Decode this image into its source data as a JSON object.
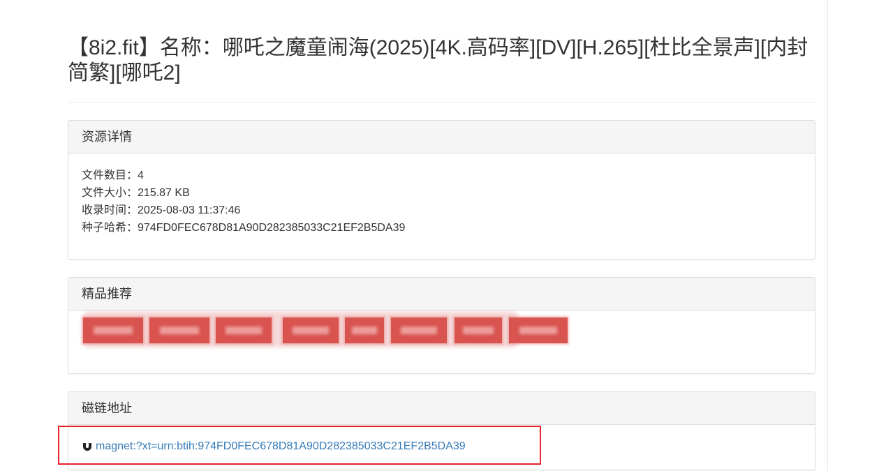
{
  "title": "【8i2.fit】名称：哪吒之魔童闹海(2025)[4K.高码率][DV][H.265][杜比全景声][内封简繁][哪吒2]",
  "details": {
    "heading": "资源详情",
    "rows": [
      {
        "label": "文件数目：",
        "value": "4"
      },
      {
        "label": "文件大小：",
        "value": "215.87 KB"
      },
      {
        "label": "收录时间：",
        "value": "2025-08-03 11:37:46"
      },
      {
        "label": "种子哈希：",
        "value": "974FD0FEC678D81A90D282385033C21EF2B5DA39"
      }
    ]
  },
  "recommend": {
    "heading": "精品推荐",
    "redacted_count": 8,
    "redaction_color": "#d9534f"
  },
  "magnet": {
    "heading": "磁链地址",
    "icon": "magnet-icon",
    "link_text": "magnet:?xt=urn:btih:974FD0FEC678D81A90D282385033C21EF2B5DA39",
    "link_color": "#337ab7"
  },
  "annotation": {
    "color": "#e8242a"
  }
}
